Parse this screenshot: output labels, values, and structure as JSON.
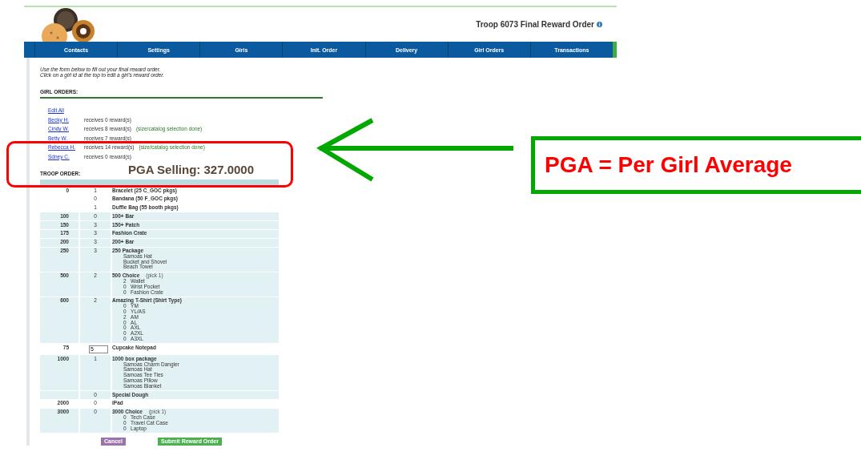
{
  "header": {
    "title": "Troop 6073 Final Reward Order"
  },
  "nav": {
    "tabs": [
      {
        "label": "Contacts"
      },
      {
        "label": "Settings"
      },
      {
        "label": "Girls"
      },
      {
        "label": "Init. Order"
      },
      {
        "label": "Delivery"
      },
      {
        "label": "Girl Orders"
      },
      {
        "label": "Transactions"
      }
    ]
  },
  "instructions": [
    "Use the form below to fill out your final reward order.",
    "Click on a girl id at the top to edit a girl's reward order."
  ],
  "girl_orders": {
    "heading": "GIRL ORDERS:",
    "edit_all": "Edit All",
    "girls": [
      {
        "name": "Becky H.",
        "summary": "receives 0 reward(s)"
      },
      {
        "name": "Cindy W.",
        "summary": "receives 8 reward(s)",
        "status": "(size/catalog selection done)"
      },
      {
        "name": "Betty W.",
        "summary": "receives 7 reward(s)"
      },
      {
        "name": "Rebecca H.",
        "summary": "receives 14 reward(s)",
        "status": "(size/catalog selection done)"
      },
      {
        "name": "Sdney C.",
        "summary": "receives 0 reward(s)"
      }
    ]
  },
  "pga": "PGA Selling: 327.0000",
  "troop_order": {
    "heading": "TROOP ORDER:",
    "rows": [
      {
        "goal": "0",
        "quantity": "1",
        "reward": "Bracelet (25 C_GOC pkgs)",
        "shaded": false,
        "editable": false
      },
      {
        "quantity": "0",
        "reward": "Bandana (50 F_GOC pkgs)",
        "shaded": false,
        "editable": false
      },
      {
        "quantity": "1",
        "reward": "Duffle Bag (55 booth pkgs)",
        "shaded": false,
        "editable": false
      },
      {
        "goal": "100",
        "quantity": "0",
        "reward": "100+ Bar",
        "shaded": true,
        "editable": false
      },
      {
        "goal": "150",
        "quantity": "3",
        "reward": "150+ Patch",
        "shaded": true,
        "editable": false
      },
      {
        "goal": "175",
        "quantity": "3",
        "reward": "Fashion Crate",
        "shaded": true,
        "editable": false
      },
      {
        "goal": "200",
        "quantity": "3",
        "reward": "200+ Bar",
        "shaded": true,
        "editable": false
      },
      {
        "goal": "250",
        "quantity": "3",
        "reward": "250 Package",
        "shaded": true,
        "editable": false,
        "items": [
          {
            "name": "Samoas Hat"
          },
          {
            "name": "Bucket and Shovel"
          },
          {
            "name": "Beach Towel"
          }
        ]
      },
      {
        "goal": "500",
        "quantity": "2",
        "reward": "500 Choice",
        "note": "(pick 1)",
        "shaded": true,
        "editable": false,
        "items": [
          {
            "count": "2",
            "name": "Wallet"
          },
          {
            "count": "0",
            "name": "Wrist Pocket"
          },
          {
            "count": "0",
            "name": "Fashion Crate"
          }
        ]
      },
      {
        "goal": "600",
        "quantity": "2",
        "reward": "Amazing T-Shirt (Shirt Type)",
        "shaded": true,
        "editable": false,
        "items": [
          {
            "count": "0",
            "name": "YM"
          },
          {
            "count": "0",
            "name": "YL/AS"
          },
          {
            "count": "2",
            "name": "AM"
          },
          {
            "count": "0",
            "name": "AL"
          },
          {
            "count": "0",
            "name": "AXL"
          },
          {
            "count": "0",
            "name": "A2XL"
          },
          {
            "count": "0",
            "name": "A3XL"
          }
        ]
      },
      {
        "goal": "75",
        "quantity": "5",
        "reward": "Cupcake Notepad",
        "shaded": false,
        "editable": true
      },
      {
        "goal": "1000",
        "quantity": "1",
        "reward": "1000 box package",
        "shaded": true,
        "editable": false,
        "items": [
          {
            "name": "Samoas Charm Dangler"
          },
          {
            "name": "Samoas Hat"
          },
          {
            "name": "Samoas Tee Ties"
          },
          {
            "name": "Samoas Pillow"
          },
          {
            "name": "Samoas Blanket"
          }
        ]
      },
      {
        "quantity": "0",
        "reward": "Special Dough",
        "shaded": true,
        "editable": false
      },
      {
        "goal": "2000",
        "quantity": "0",
        "reward": "iPad",
        "shaded": false,
        "editable": false
      },
      {
        "goal": "3000",
        "quantity": "0",
        "reward": "3000 Choice",
        "note": "(pick 1)",
        "shaded": true,
        "editable": false,
        "items": [
          {
            "count": "0",
            "name": "Tech Case"
          },
          {
            "count": "0",
            "name": "Travel Cat Case"
          },
          {
            "count": "0",
            "name": "Laptop"
          }
        ]
      }
    ]
  },
  "buttons": [
    {
      "label": "Cancel",
      "kind": "cancel"
    },
    {
      "label": "Submit Reward Order",
      "kind": "submit"
    }
  ],
  "annotation": {
    "label": "PGA = Per Girl Average"
  }
}
